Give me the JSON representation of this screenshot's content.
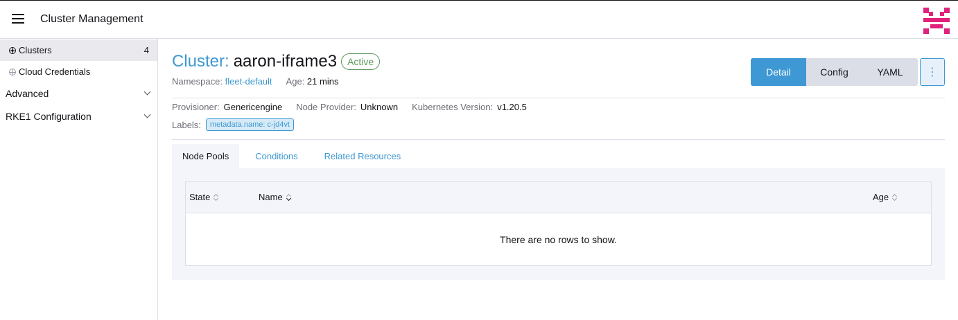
{
  "header": {
    "title": "Cluster Management"
  },
  "sidebar": {
    "items": [
      {
        "label": "Clusters",
        "count": "4"
      },
      {
        "label": "Cloud Credentials"
      }
    ],
    "groups": [
      {
        "label": "Advanced"
      },
      {
        "label": "RKE1 Configuration"
      }
    ]
  },
  "cluster": {
    "prefix": "Cluster:",
    "name": "aaron-iframe3",
    "status": "Active",
    "namespace_label": "Namespace:",
    "namespace_value": "fleet-default",
    "age_label": "Age:",
    "age_value": "21 mins"
  },
  "view_buttons": {
    "detail": "Detail",
    "config": "Config",
    "yaml": "YAML",
    "more": "⋮"
  },
  "details": {
    "provisioner_label": "Provisioner:",
    "provisioner_value": "Genericengine",
    "node_provider_label": "Node Provider:",
    "node_provider_value": "Unknown",
    "k8s_label": "Kubernetes Version:",
    "k8s_value": "v1.20.5",
    "labels_label": "Labels:",
    "label_tag": "metadata.name: c-jd4vt"
  },
  "tabs": [
    {
      "label": "Node Pools"
    },
    {
      "label": "Conditions"
    },
    {
      "label": "Related Resources"
    }
  ],
  "table": {
    "columns": [
      "State",
      "Name",
      "Age"
    ],
    "empty_message": "There are no rows to show."
  },
  "colors": {
    "accent": "#3d98d3",
    "success": "#5d995d",
    "logo": "#e0227d"
  },
  "icons": {
    "menu": "hamburger-icon",
    "clusters": "globe-icon",
    "credentials": "globe-icon",
    "expand": "chevron-down-icon",
    "more": "kebab-icon",
    "sort": "sort-icon"
  }
}
